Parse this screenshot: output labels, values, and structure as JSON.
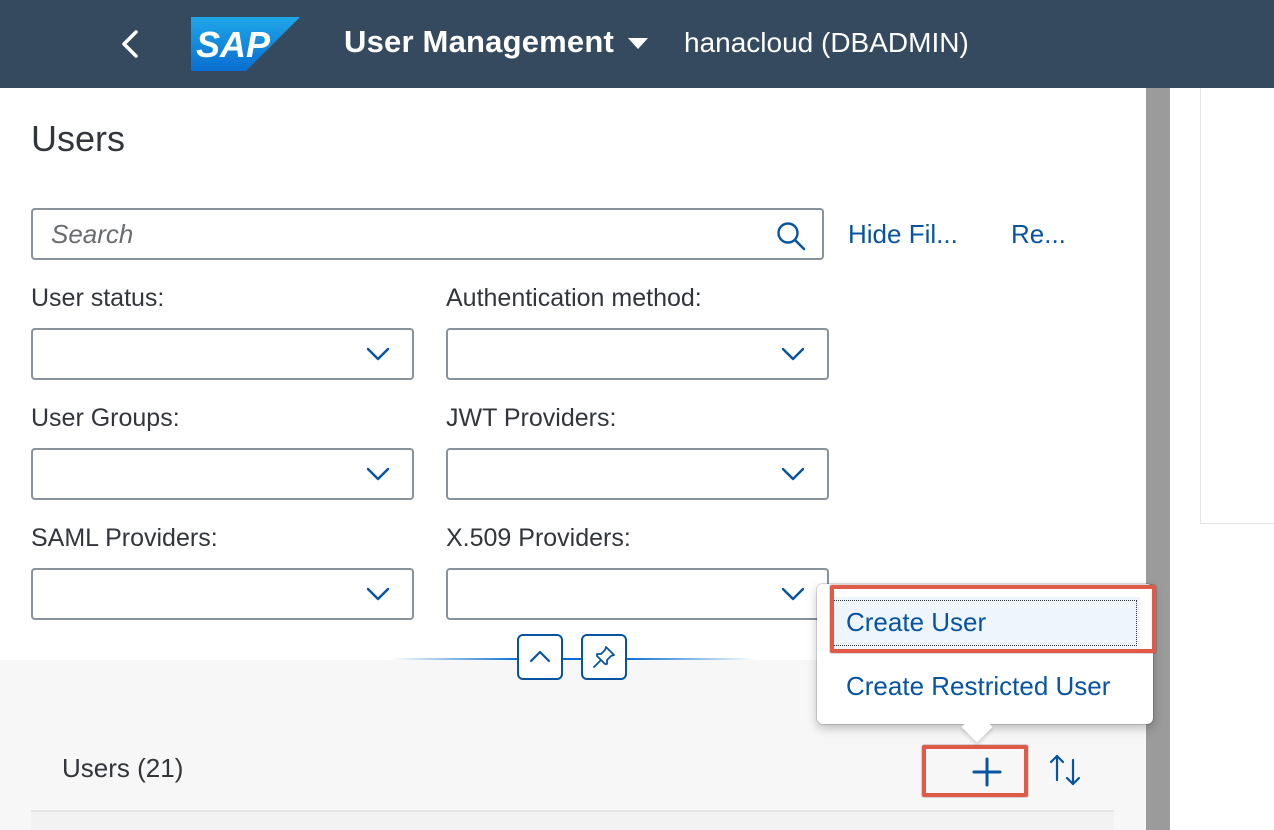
{
  "shell": {
    "logo_text": "SAP",
    "app_title": "User Management",
    "system": "hanacloud (DBADMIN)"
  },
  "page": {
    "title": "Users"
  },
  "filterbar": {
    "search_placeholder": "Search",
    "hide_filters": "Hide Fil...",
    "reset": "Re...",
    "filters": [
      {
        "label": "User status:",
        "value": ""
      },
      {
        "label": "Authentication method:",
        "value": ""
      },
      {
        "label": "User Groups:",
        "value": ""
      },
      {
        "label": "JWT Providers:",
        "value": ""
      },
      {
        "label": "SAML Providers:",
        "value": ""
      },
      {
        "label": "X.509 Providers:",
        "value": ""
      }
    ]
  },
  "table": {
    "title": "Users (21)"
  },
  "menu": {
    "items": [
      {
        "label": "Create User"
      },
      {
        "label": "Create Restricted User"
      }
    ]
  },
  "colors": {
    "shell": "#354a5f",
    "link": "#0854a0",
    "highlight": "#e05a47"
  },
  "icons": [
    "back-icon",
    "dropdown-caret-icon",
    "search-icon",
    "chevron-down-icon",
    "chevron-up-icon",
    "pin-icon",
    "add-icon",
    "sort-icon"
  ]
}
